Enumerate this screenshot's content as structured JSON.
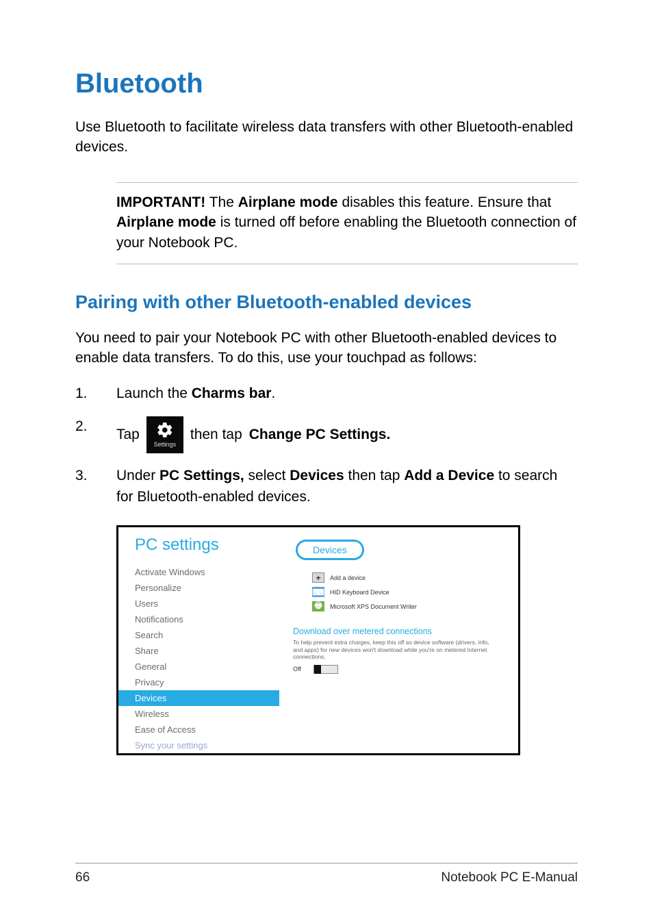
{
  "h1": "Bluetooth",
  "intro": "Use Bluetooth to facilitate wireless data transfers with other Bluetooth-enabled devices.",
  "callout": {
    "lead": "IMPORTANT!",
    "t1": " The ",
    "b1": "Airplane mode",
    "t2": " disables this feature. Ensure that ",
    "b2": "Airplane mode",
    "t3": " is turned off before enabling the Bluetooth connection of your Notebook PC."
  },
  "h2": "Pairing with other Bluetooth-enabled devices",
  "pairing_intro": "You need to pair your Notebook PC with other Bluetooth-enabled devices to enable data transfers. To do this, use your touchpad as follows:",
  "steps": {
    "s1": {
      "num": "1.",
      "t1": "Launch the ",
      "b1": "Charms bar",
      "t2": "."
    },
    "s2": {
      "num": "2.",
      "t1": "Tap ",
      "tile_label": "Settings",
      "t2": " then tap ",
      "b1": "Change PC Settings."
    },
    "s3": {
      "num": "3.",
      "t1": "Under ",
      "b1": "PC Settings,",
      "t2": " select ",
      "b2": "Devices",
      "t3": " then tap ",
      "b3": "Add a Device",
      "t4": " to search for Bluetooth-enabled devices."
    }
  },
  "screenshot": {
    "left_title": "PC settings",
    "items": [
      "Activate Windows",
      "Personalize",
      "Users",
      "Notifications",
      "Search",
      "Share",
      "General",
      "Privacy",
      "Devices",
      "Wireless",
      "Ease of Access",
      "Sync your settings"
    ],
    "active_index": 8,
    "right": {
      "devices_label": "Devices",
      "add": "Add a device",
      "dev1": "HID Keyboard Device",
      "dev2": "Microsoft XPS Document Writer",
      "dl_heading": "Download over metered connections",
      "dl_desc": "To help prevent extra charges, keep this off so device software (drivers, info, and apps) for new devices won't download while you're on metered Internet connections.",
      "toggle_state": "Off"
    }
  },
  "footer": {
    "page": "66",
    "title": "Notebook PC E-Manual"
  }
}
